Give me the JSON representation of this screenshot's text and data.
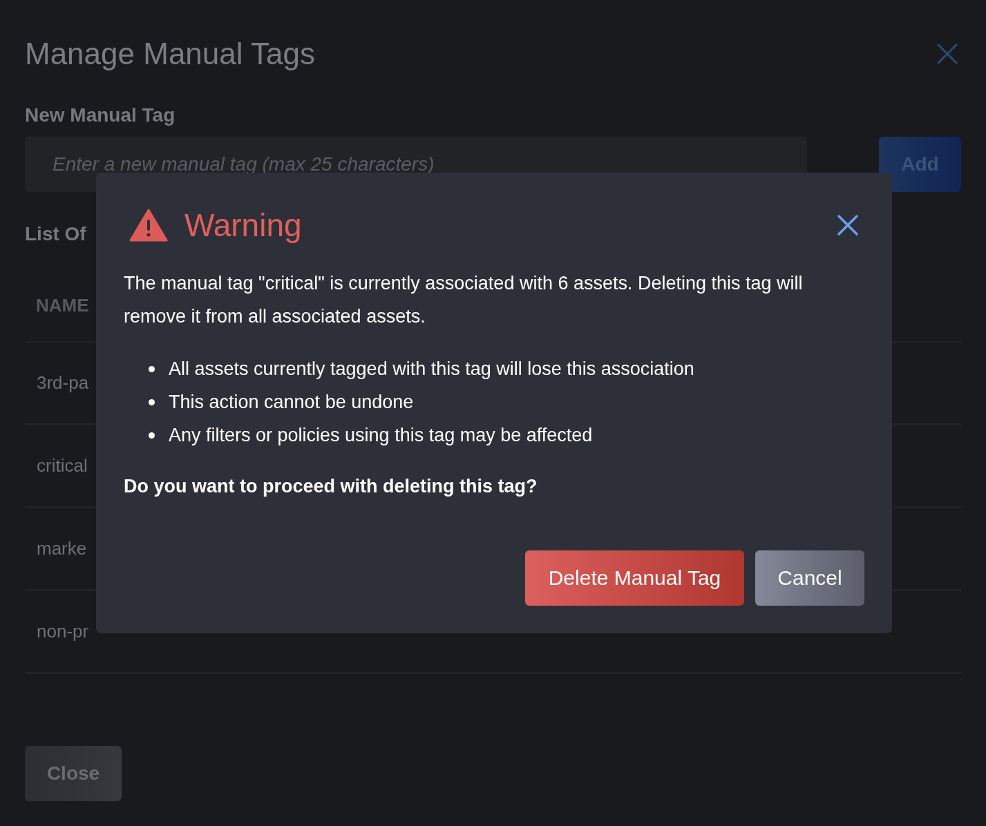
{
  "page": {
    "title": "Manage Manual Tags",
    "new_tag_label": "New Manual Tag",
    "new_tag_field": {
      "placeholder": "Enter a new manual tag (max 25 characters)"
    },
    "add_button": "Add",
    "list_heading": "List Of",
    "table": {
      "columns": [
        "NAME"
      ],
      "rows": [
        "3rd-pa",
        "critical",
        "marke",
        "non-pr"
      ]
    },
    "close_button": "Close"
  },
  "dialog": {
    "title": "Warning",
    "message": "The manual tag \"critical\" is currently associated with 6 assets. Deleting this tag will remove it from all associated assets.",
    "bullets": [
      "All assets currently tagged with this tag will lose this association",
      "This action cannot be undone",
      "Any filters or policies using this tag may be affected"
    ],
    "question": "Do you want to proceed with deleting this tag?",
    "buttons": [
      {
        "label": "Delete Manual Tag",
        "kind": "danger"
      },
      {
        "label": "Cancel",
        "kind": "secondary"
      }
    ]
  }
}
